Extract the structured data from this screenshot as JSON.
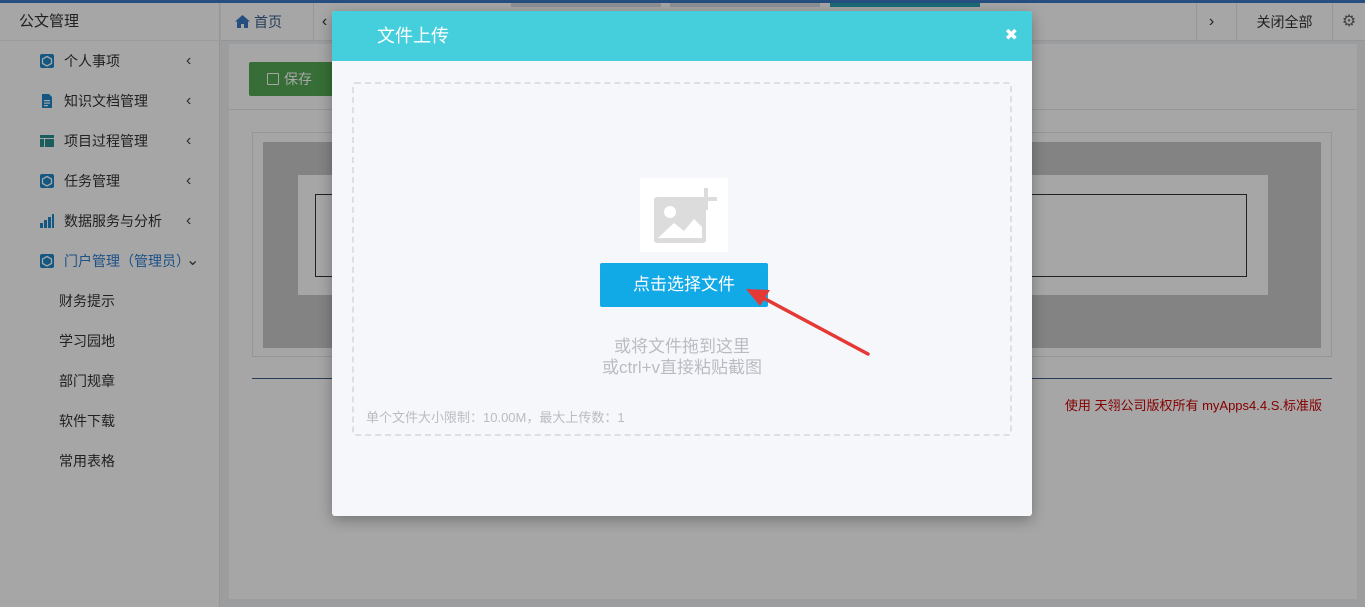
{
  "sidebar": {
    "app_title": "公文管理",
    "items": [
      {
        "label": "个人事项",
        "icon": "cube-icon",
        "expanded": false
      },
      {
        "label": "知识文档管理",
        "icon": "document-icon",
        "expanded": false
      },
      {
        "label": "项目过程管理",
        "icon": "table-icon",
        "expanded": false
      },
      {
        "label": "任务管理",
        "icon": "cube-icon",
        "expanded": false
      },
      {
        "label": "数据服务与分析",
        "icon": "bar-chart-icon",
        "expanded": false
      },
      {
        "label": "门户管理（管理员）",
        "icon": "cube-icon",
        "expanded": true
      }
    ],
    "sub_items": [
      "财务提示",
      "学习园地",
      "部门规章",
      "软件下载",
      "常用表格"
    ]
  },
  "tabbar": {
    "home_label": "首页",
    "close_all_label": "关闭全部"
  },
  "content": {
    "save_label": "保存",
    "footer": "使用 天翎公司版权所有 myApps4.4.S.标准版"
  },
  "modal": {
    "title": "文件上传",
    "choose_button": "点击选择文件",
    "hint_line1": "或将文件拖到这里",
    "hint_line2": "或ctrl+v直接粘贴截图",
    "limit_text": "单个文件大小限制：10.00M，最大上传数：1"
  },
  "colors": {
    "accent": "#45cfdc",
    "primary_button": "#11a9e6",
    "save_button": "#55aa55",
    "active_menu": "#2d7dd2",
    "annotation_arrow": "#e53935"
  }
}
